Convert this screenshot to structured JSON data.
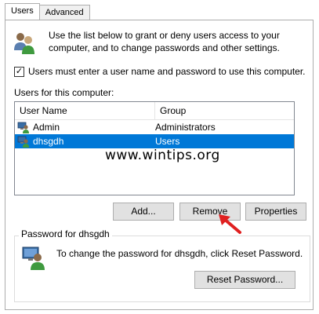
{
  "tabs": [
    {
      "label": "Users",
      "active": true
    },
    {
      "label": "Advanced",
      "active": false
    }
  ],
  "intro_text": "Use the list below to grant or deny users access to your computer, and to change passwords and other settings.",
  "require_login": {
    "label": "Users must enter a user name and password to use this computer.",
    "checked": true,
    "check_glyph": "✓"
  },
  "users_section_label": "Users for this computer:",
  "table": {
    "columns": [
      "User Name",
      "Group"
    ],
    "rows": [
      {
        "user": "Admin",
        "group": "Administrators",
        "selected": false
      },
      {
        "user": "dhsgdh",
        "group": "Users",
        "selected": true
      }
    ]
  },
  "buttons": {
    "add": "Add...",
    "remove": "Remove",
    "properties": "Properties",
    "reset_password": "Reset Password..."
  },
  "password_group": {
    "title": "Password for dhsgdh",
    "text": "To change the password for dhsgdh, click Reset Password."
  },
  "watermark": "www.wintips.org",
  "colors": {
    "selection": "#0078d7",
    "arrow": "#e02020"
  }
}
